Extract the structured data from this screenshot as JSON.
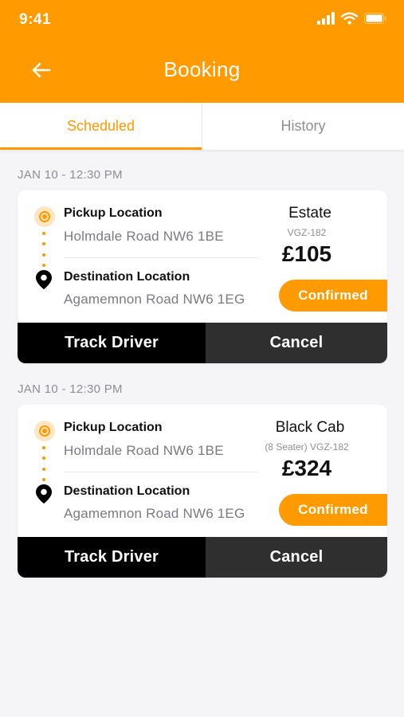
{
  "status_bar": {
    "time": "9:41"
  },
  "header": {
    "title": "Booking",
    "back_icon": "arrow-left-icon"
  },
  "tabs": [
    {
      "label": "Scheduled",
      "active": true
    },
    {
      "label": "History",
      "active": false
    }
  ],
  "bookings": [
    {
      "date": "JAN 10 - 12:30 PM",
      "pickup_label": "Pickup Location",
      "pickup_address": "Holmdale Road NW6 1BE",
      "destination_label": "Destination Location",
      "destination_address": "Agamemnon Road NW6 1EG",
      "car_type": "Estate",
      "car_reg": "VGZ-182",
      "price": "£105",
      "status": "Confirmed",
      "track_label": "Track Driver",
      "cancel_label": "Cancel"
    },
    {
      "date": "JAN 10 - 12:30 PM",
      "pickup_label": "Pickup Location",
      "pickup_address": "Holmdale Road NW6 1BE",
      "destination_label": "Destination Location",
      "destination_address": "Agamemnon Road NW6 1EG",
      "car_type": "Black Cab",
      "car_reg": "(8 Seater) VGZ-182",
      "price": "£324",
      "status": "Confirmed",
      "track_label": "Track Driver",
      "cancel_label": "Cancel"
    }
  ],
  "colors": {
    "accent": "#FF9A00",
    "track_button": "#000000",
    "cancel_button": "#2F2F2F"
  }
}
